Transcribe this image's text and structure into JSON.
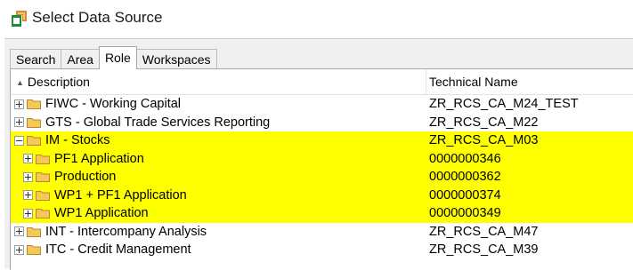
{
  "window": {
    "title": "Select Data Source"
  },
  "tabs": [
    {
      "label": "Search",
      "active": false
    },
    {
      "label": "Area",
      "active": false
    },
    {
      "label": "Role",
      "active": true
    },
    {
      "label": "Workspaces",
      "active": false
    }
  ],
  "columns": {
    "description": "Description",
    "technical_name": "Technical Name"
  },
  "rows": [
    {
      "description": "FIWC - Working Capital",
      "technical_name": "ZR_RCS_CA_M24_TEST"
    },
    {
      "description": "GTS - Global Trade Services Reporting",
      "technical_name": "ZR_RCS_CA_M22"
    },
    {
      "description": "IM - Stocks",
      "technical_name": "ZR_RCS_CA_M03"
    },
    {
      "description": "PF1 Application",
      "technical_name": "0000000346"
    },
    {
      "description": "Production",
      "technical_name": "0000000362"
    },
    {
      "description": "WP1 + PF1 Application",
      "technical_name": "0000000374"
    },
    {
      "description": "WP1 Application",
      "technical_name": "0000000349"
    },
    {
      "description": "INT - Intercompany Analysis",
      "technical_name": "ZR_RCS_CA_M47"
    },
    {
      "description": "ITC - Credit Management",
      "technical_name": "ZR_RCS_CA_M39"
    }
  ],
  "colors": {
    "highlight": "#ffff00",
    "folder": "#f5c85a"
  },
  "icons": {
    "title": "data-source-icon",
    "folder": "folder-icon",
    "expand": "plus-icon",
    "collapse": "minus-icon",
    "sort": "sort-ascending-icon"
  }
}
